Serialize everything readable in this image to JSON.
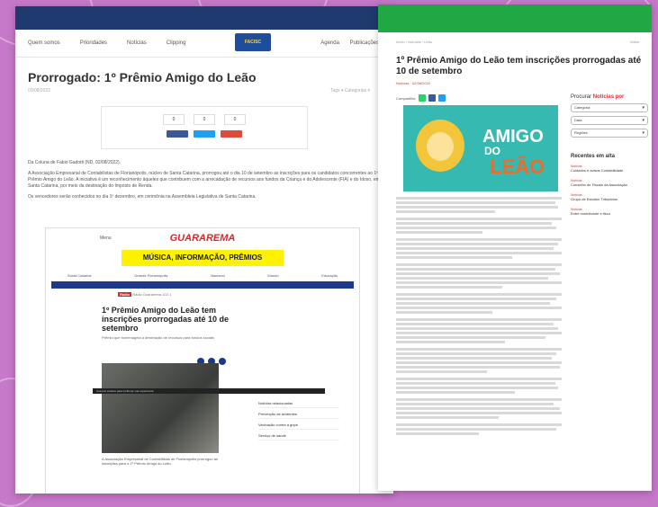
{
  "left_page": {
    "nav": [
      "Quem somos",
      "Prioridades",
      "Notícias",
      "Clipping"
    ],
    "nav_right": [
      "Agenda",
      "Publicações"
    ],
    "logo_text": "FACISC",
    "title": "Prorrogado: 1º Prêmio Amigo do Leão",
    "date": "03/08/2022",
    "tags_text": "Tags ▾   Categorias ▾",
    "share_counts": [
      "0",
      "0",
      "0"
    ],
    "share_buttons": [
      {
        "color": "#3b5998"
      },
      {
        "color": "#1da1f2"
      },
      {
        "color": "#dd4b39"
      }
    ],
    "source": "Da Coluna de Fabio Gadotti (ND, 02/08/2022).",
    "paragraph1": "A Associação Empresarial de Contabilistas de Florianópolis, núcleo de Santa Catarina, prorrogou até o dia 10 de setembro as inscrições para os candidatos concorrentes ao 1º Prêmio Amigo do Leão. A iniciativa é um reconhecimento àqueles que contribuem com a arrecadação de recursos aos fundos da Criança e do Adolescente (FIA) e do Idoso, em Santa Catarina, por meio da destinação do Imposto de Renda.",
    "paragraph2": "Os vencedores serão conhecidos no dia 1º dezembro, em cerimônia na Assembleia Legislativa de Santa Catarina."
  },
  "inner_page": {
    "logo": "GUARAREMA",
    "menu": "Menu",
    "banner": "MÚSICA, INFORMAÇÃO, PRÊMIOS",
    "categories": [
      "Santa Catarina",
      "Grande Florianópolis",
      "Nacional",
      "Mundo",
      "Educação"
    ],
    "ticker_tag": "Rádio",
    "ticker": "Rádio Guararema 102.1",
    "headline": "1º Prêmio Amigo do Leão tem inscrições prorrogadas até 10 de setembro",
    "subheadline": "Prêmio que homenageia a destinação de recursos para fundos sociais",
    "cookie": "Usamos cookies para melhorar sua experiência.",
    "side_items": [
      "Notícias relacionadas",
      "Prevenção de acidentes",
      "Vacinação contra a gripe",
      "Serviço de saúde"
    ],
    "body": "A Associação Empresarial de Contabilistas de Florianópolis prorrogou as inscrições para o 1º Prêmio Amigo do Leão."
  },
  "right_page": {
    "breadcrumb": "Início › Notícias › Leão",
    "breadcrumb_right": "Voltar",
    "title": "1º Prêmio Amigo do Leão tem inscrições prorrogadas até 10 de setembro",
    "meta": "Notícias · 02/08/2022",
    "share_label": "Compartilhe",
    "share_colors": [
      "#25d366",
      "#3b5998",
      "#1da1f2"
    ],
    "art_text1": "AMIGO",
    "art_text2": "DO",
    "art_text3": "LEÃO",
    "search_label_prefix": "Procurar",
    "search_label_highlight": "Notícias por",
    "filters": [
      "Categoria",
      "Data",
      "Regiões"
    ],
    "recent_title": "Recentes em alta",
    "recent_news": [
      {
        "tag": "Notícias",
        "text": "Cuidados e avisos Contabilidade"
      },
      {
        "tag": "Notícias",
        "text": "Conselho de Fiscais da Associação"
      },
      {
        "tag": "Notícias",
        "text": "Grupo de Estudos Tributários"
      },
      {
        "tag": "Notícias",
        "text": "Entre contribuinte e fisco"
      }
    ]
  }
}
